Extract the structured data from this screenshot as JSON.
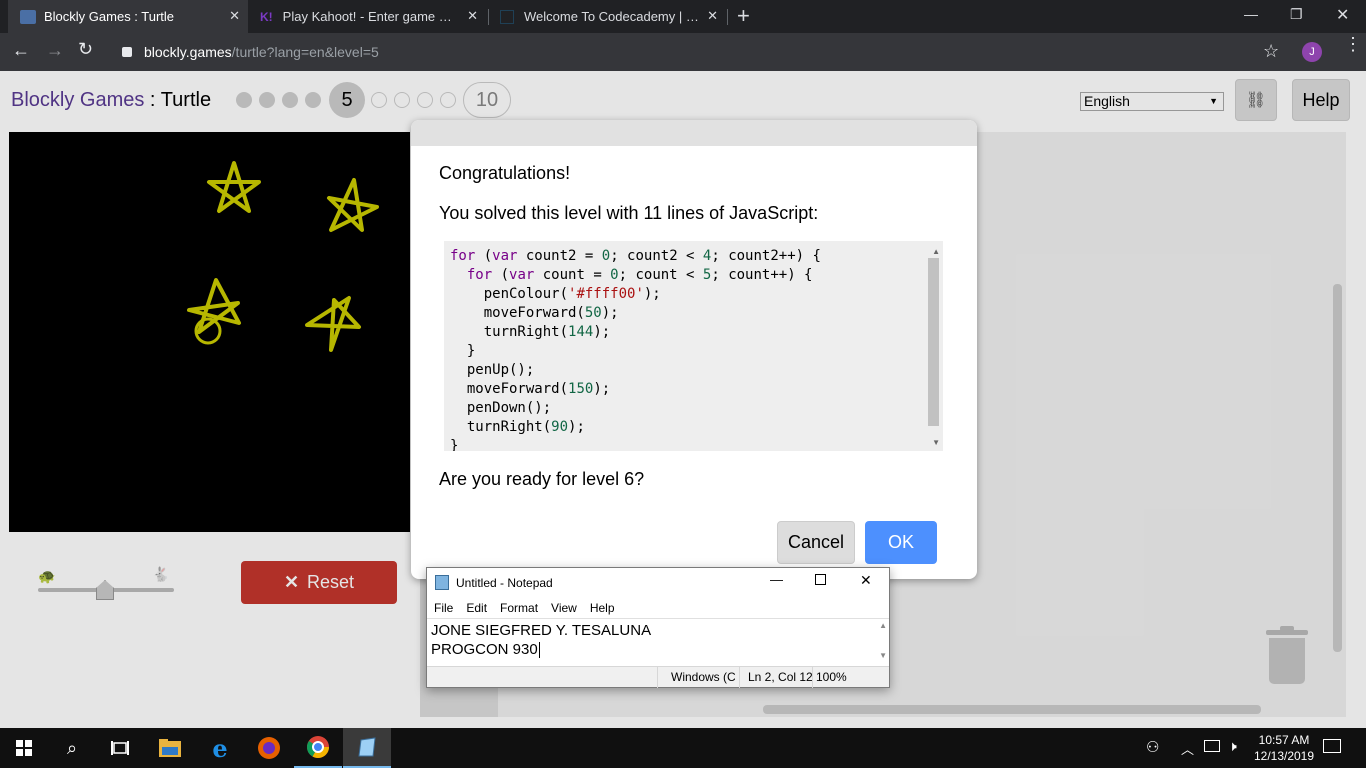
{
  "browser": {
    "tabs": [
      {
        "title": "Blockly Games : Turtle",
        "active": true
      },
      {
        "title": "Play Kahoot! - Enter game PIN he",
        "active": false
      },
      {
        "title": "Welcome To Codecademy | Code",
        "active": false
      }
    ],
    "new_tab": "+",
    "url_host": "blockly.games",
    "url_path": "/turtle?lang=en&level=5",
    "profile_initial": "J"
  },
  "page": {
    "title_app": "Blockly Games",
    "title_sep": " : ",
    "title_game": "Turtle",
    "current_level": "5",
    "max_level": "10",
    "language": "English",
    "help_label": "Help",
    "reset_label": "Reset"
  },
  "dialog": {
    "heading": "Congratulations!",
    "summary": "You solved this level with 11 lines of JavaScript:",
    "question": "Are you ready for level 6?",
    "cancel_label": "Cancel",
    "ok_label": "OK"
  },
  "notepad": {
    "title": "Untitled - Notepad",
    "menu": [
      "File",
      "Edit",
      "Format",
      "View",
      "Help"
    ],
    "line1": "JONE SIEGFRED Y. TESALUNA",
    "line2": "PROGCON 930",
    "status_encoding": "Windows (C",
    "status_position": "Ln 2, Col 12",
    "status_zoom": "100%"
  },
  "taskbar": {
    "time": "10:57 AM",
    "date": "12/13/2019"
  },
  "colors": {
    "star": "#cccc00",
    "reset_btn": "#c4362d",
    "ok_btn": "#4d90fe",
    "title_purple": "#5a3a94"
  },
  "icons": [
    "back-icon",
    "forward-icon",
    "reload-icon",
    "lock-icon",
    "star-icon",
    "link-icon",
    "turtle-icon",
    "rabbit-icon",
    "trash-icon",
    "windows-icon",
    "search-icon",
    "task-view-icon",
    "file-explorer-icon",
    "edge-icon",
    "firefox-icon",
    "chrome-icon",
    "notepad-icon",
    "people-icon",
    "chevron-up-icon",
    "network-icon",
    "volume-icon",
    "notification-icon"
  ]
}
